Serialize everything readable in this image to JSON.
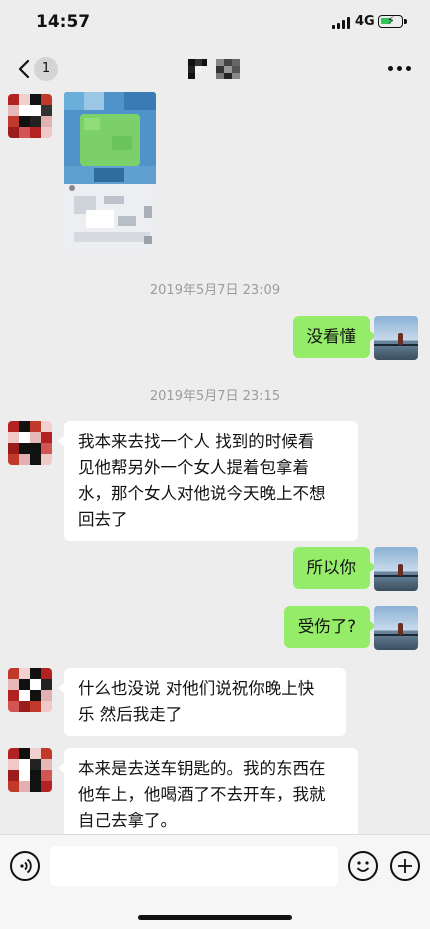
{
  "status_bar": {
    "time": "14:57",
    "network": "4G",
    "battery_icon": "battery-charging-icon",
    "signal_icon": "signal-icon"
  },
  "nav": {
    "unread_count": "1",
    "back_icon": "chevron-left-icon",
    "more_icon": "more-dots-icon"
  },
  "colors": {
    "background": "#ededed",
    "incoming_bubble": "#ffffff",
    "outgoing_bubble": "#95ec69",
    "timestamp": "#9c9c9c"
  },
  "messages": [
    {
      "id": "m1",
      "type": "image",
      "direction": "in"
    },
    {
      "id": "t1",
      "type": "timestamp",
      "text": "2019年5月7日 23:09"
    },
    {
      "id": "m2",
      "type": "text",
      "direction": "out",
      "text": "没看懂"
    },
    {
      "id": "t2",
      "type": "timestamp",
      "text": "2019年5月7日 23:15"
    },
    {
      "id": "m3",
      "type": "text",
      "direction": "in",
      "lines": [
        "我本来去找一个人 找到的时候看",
        "见他帮另外一个女人提着包拿着",
        "水，那个女人对他说今天晚上不想",
        "回去了"
      ]
    },
    {
      "id": "m4",
      "type": "text",
      "direction": "out",
      "text": "所以你"
    },
    {
      "id": "m5",
      "type": "text",
      "direction": "out",
      "text": "受伤了?"
    },
    {
      "id": "m6",
      "type": "text",
      "direction": "in",
      "lines": [
        "什么也没说 对他们说祝你晚上快",
        "乐 然后我走了"
      ]
    },
    {
      "id": "m7",
      "type": "text",
      "direction": "in",
      "lines": [
        "本来是去送车钥匙的。我的东西在",
        "他车上，他喝酒了不去开车，我就",
        "自己去拿了。"
      ]
    }
  ],
  "input_bar": {
    "voice_icon": "voice-icon",
    "emoji_icon": "emoji-icon",
    "plus_icon": "plus-icon",
    "value": ""
  }
}
